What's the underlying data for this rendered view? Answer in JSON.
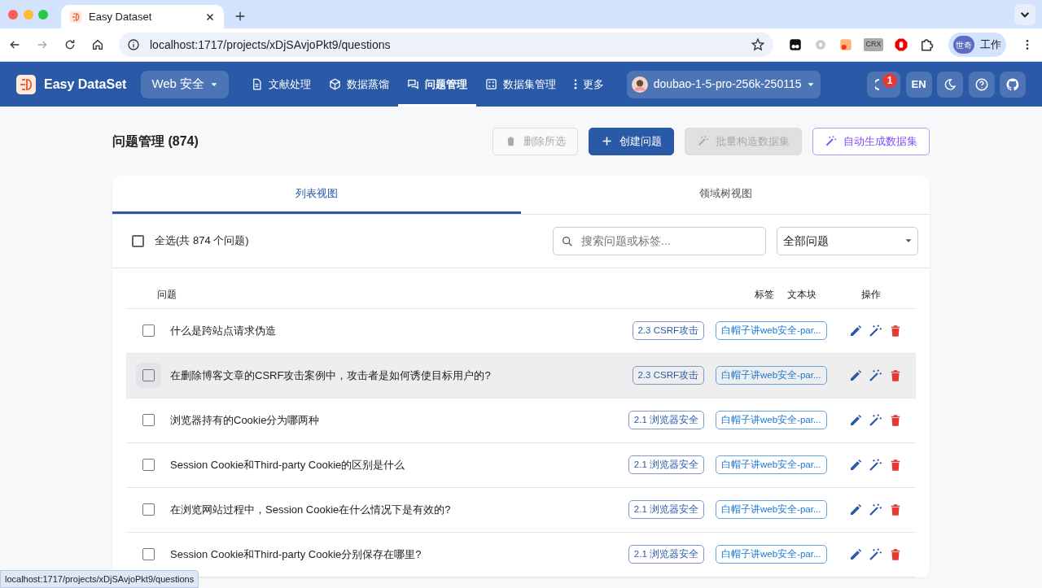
{
  "browser": {
    "tab_title": "Easy Dataset",
    "url": "localhost:1717/projects/xDjSAvjoPkt9/questions",
    "crx_label": "CRX",
    "profile_avatar": "世奇",
    "profile_label": "工作"
  },
  "app": {
    "brand": "Easy DataSet",
    "project": "Web 安全",
    "nav": [
      {
        "label": "文献处理",
        "kind": "document",
        "selected": false
      },
      {
        "label": "数据蒸馏",
        "kind": "cube",
        "selected": false
      },
      {
        "label": "问题管理",
        "kind": "chat",
        "selected": true
      },
      {
        "label": "数据集管理",
        "kind": "grid",
        "selected": false
      },
      {
        "label": "更多",
        "kind": "more",
        "selected": false
      }
    ],
    "model": "doubao-1-5-pro-256k-250115",
    "notification_count": "1",
    "language": "EN"
  },
  "page": {
    "title": "问题管理 (874)",
    "buttons": [
      {
        "label": "删除所选",
        "kind": "delete",
        "disabled": true
      },
      {
        "label": "创建问题",
        "kind": "create",
        "disabled": false
      },
      {
        "label": "批量构造数据集",
        "kind": "batch",
        "disabled": true
      },
      {
        "label": "自动生成数据集",
        "kind": "auto",
        "disabled": false
      }
    ],
    "view_tabs": [
      {
        "label": "列表视图",
        "selected": true
      },
      {
        "label": "领域树视图",
        "selected": false
      }
    ],
    "select_all": {
      "label": "全选(共 874 个问题)",
      "checked": false
    },
    "search": {
      "placeholder": "搜索问题或标签..."
    },
    "filter": {
      "value": "全部问题"
    },
    "table": {
      "columns": [
        "问题",
        "标签",
        "文本块",
        "操作"
      ],
      "rows": [
        {
          "question": "什么是跨站点请求伪造",
          "tag": "2.3 CSRF攻击",
          "chunk": "白帽子讲web安全-par...",
          "checked": false,
          "hovered": false
        },
        {
          "question": "在删除博客文章的CSRF攻击案例中，攻击者是如何诱使目标用户的?",
          "tag": "2.3 CSRF攻击",
          "chunk": "白帽子讲web安全-par...",
          "checked": false,
          "hovered": true
        },
        {
          "question": "浏览器持有的Cookie分为哪两种",
          "tag": "2.1 浏览器安全",
          "chunk": "白帽子讲web安全-par...",
          "checked": false,
          "hovered": false
        },
        {
          "question": "Session Cookie和Third-party Cookie的区别是什么",
          "tag": "2.1 浏览器安全",
          "chunk": "白帽子讲web安全-par...",
          "checked": false,
          "hovered": false
        },
        {
          "question": "在浏览网站过程中，Session Cookie在什么情况下是有效的?",
          "tag": "2.1 浏览器安全",
          "chunk": "白帽子讲web安全-par...",
          "checked": false,
          "hovered": false
        },
        {
          "question": "Session Cookie和Third-party Cookie分别保存在哪里?",
          "tag": "2.1 浏览器安全",
          "chunk": "白帽子讲web安全-par...",
          "checked": false,
          "hovered": false
        }
      ]
    }
  },
  "status_link": "localhost:1717/projects/xDjSAvjoPkt9/questions"
}
